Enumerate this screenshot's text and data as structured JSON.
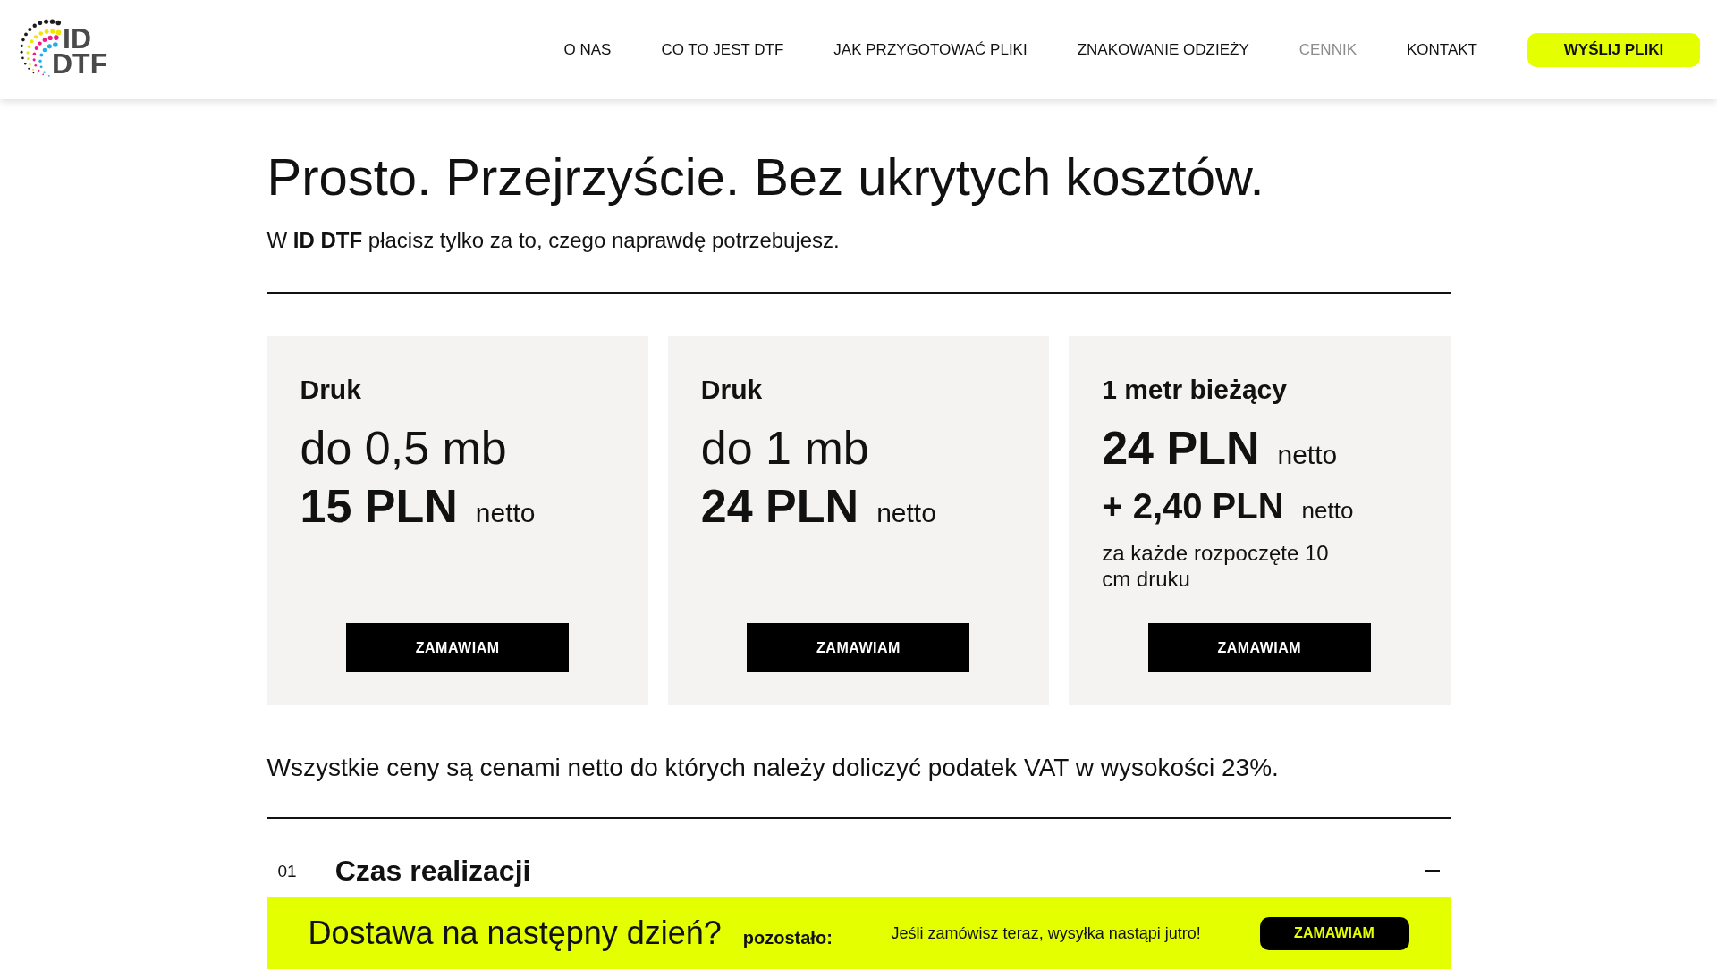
{
  "header": {
    "logo": {
      "line1": "ID",
      "line2": "DTF"
    },
    "nav": [
      {
        "label": "O NAS",
        "selected": false
      },
      {
        "label": "CO TO JEST DTF",
        "selected": false
      },
      {
        "label": "JAK PRZYGOTOWAĆ PLIKI",
        "selected": false
      },
      {
        "label": "ZNAKOWANIE ODZIEŻY",
        "selected": false
      },
      {
        "label": "CENNIK",
        "selected": true
      },
      {
        "label": "KONTAKT",
        "selected": false
      }
    ],
    "cta": "WYŚLIJ PLIKI"
  },
  "intro": {
    "title": "Prosto. Przejrzyście. Bez ukrytych kosztów.",
    "subtitle": "W **ID DTF** płacisz tylko za to, czego naprawdę potrzebujesz."
  },
  "pricing_cards": [
    {
      "kind": "range",
      "label": "Druk",
      "range": "do 0,5 mb",
      "price": "15 PLN",
      "price_note": "netto",
      "button": "ZAMAWIAM"
    },
    {
      "kind": "range",
      "label": "Druk",
      "range": "do 1 mb",
      "price": "24 PLN",
      "price_note": "netto",
      "button": "ZAMAWIAM"
    },
    {
      "kind": "meter",
      "label": "1 metr bieżący",
      "price": "24 PLN",
      "price_note": "netto",
      "extra_price": "+ 2,40 PLN",
      "extra_note": "netto",
      "extra_description": "za każde rozpoczęte 10 cm druku",
      "button": "ZAMAWIAM"
    }
  ],
  "vat_note": "Wszystkie ceny są cenami netto do których należy doliczyć podatek VAT w wysokości 23%.",
  "accordion": [
    {
      "number": "01",
      "title": "Czas realizacji",
      "expanded": true
    }
  ],
  "delivery_bar": {
    "question": "Dostawa na następny dzień?",
    "countdown_label": "pozostało:",
    "message": "Jeśli zamówisz teraz, wysyłka nastąpi jutro!",
    "button": "ZAMAWIAM"
  }
}
